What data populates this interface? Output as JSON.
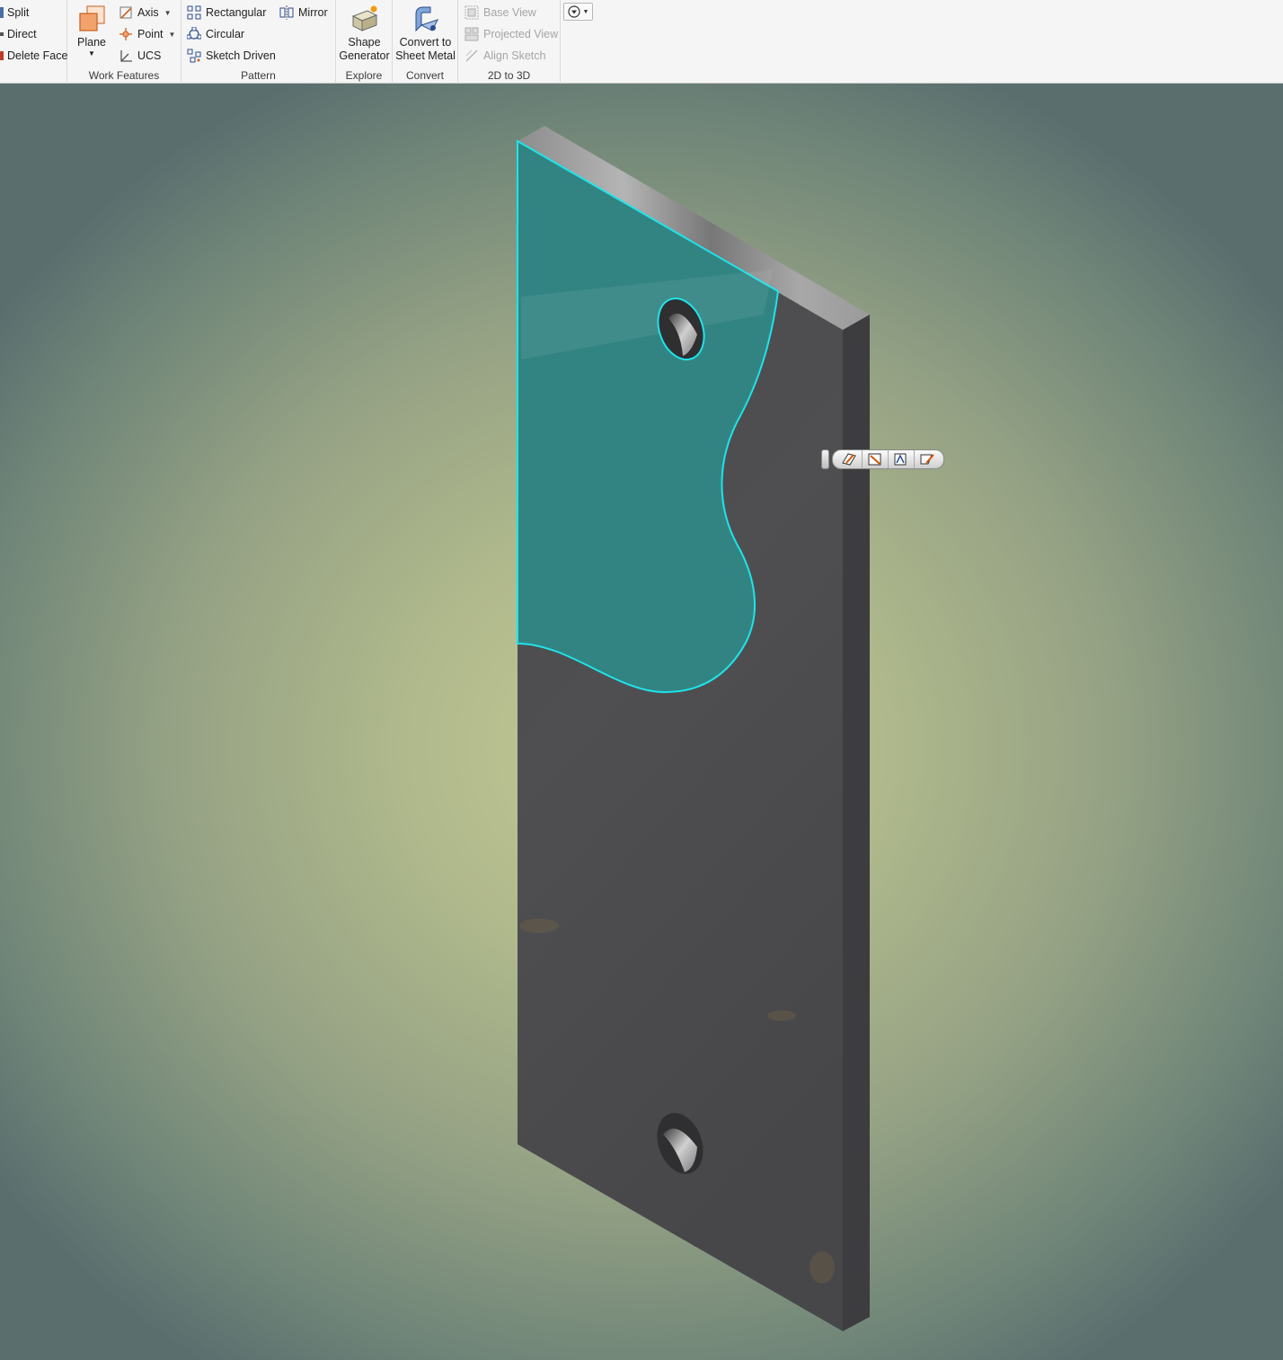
{
  "ribbon": {
    "modify": {
      "split": "Split",
      "direct": "Direct",
      "delete_face": "Delete Face"
    },
    "work_features": {
      "title": "Work Features",
      "plane": "Plane",
      "axis": "Axis",
      "point": "Point",
      "ucs": "UCS"
    },
    "pattern": {
      "title": "Pattern",
      "rectangular": "Rectangular",
      "circular": "Circular",
      "sketch_driven": "Sketch Driven",
      "mirror": "Mirror"
    },
    "explore": {
      "title": "Explore",
      "shape_generator_line1": "Shape",
      "shape_generator_line2": "Generator"
    },
    "convert": {
      "title": "Convert",
      "convert_line1": "Convert to",
      "convert_line2": "Sheet Metal"
    },
    "two_d_to_three_d": {
      "title": "2D to 3D",
      "base_view": "Base View",
      "projected_view": "Projected View",
      "align_sketch": "Align Sketch"
    }
  },
  "viewport": {
    "highlight_color": "#1fe3ea",
    "selection_fill": "#2f8c8a",
    "part_color": "#4d4d4f",
    "mini_toolbar_icons": [
      "edit-sketch-icon",
      "create-sketch-icon",
      "edit-feature-icon",
      "sketch-edit-icon"
    ]
  }
}
